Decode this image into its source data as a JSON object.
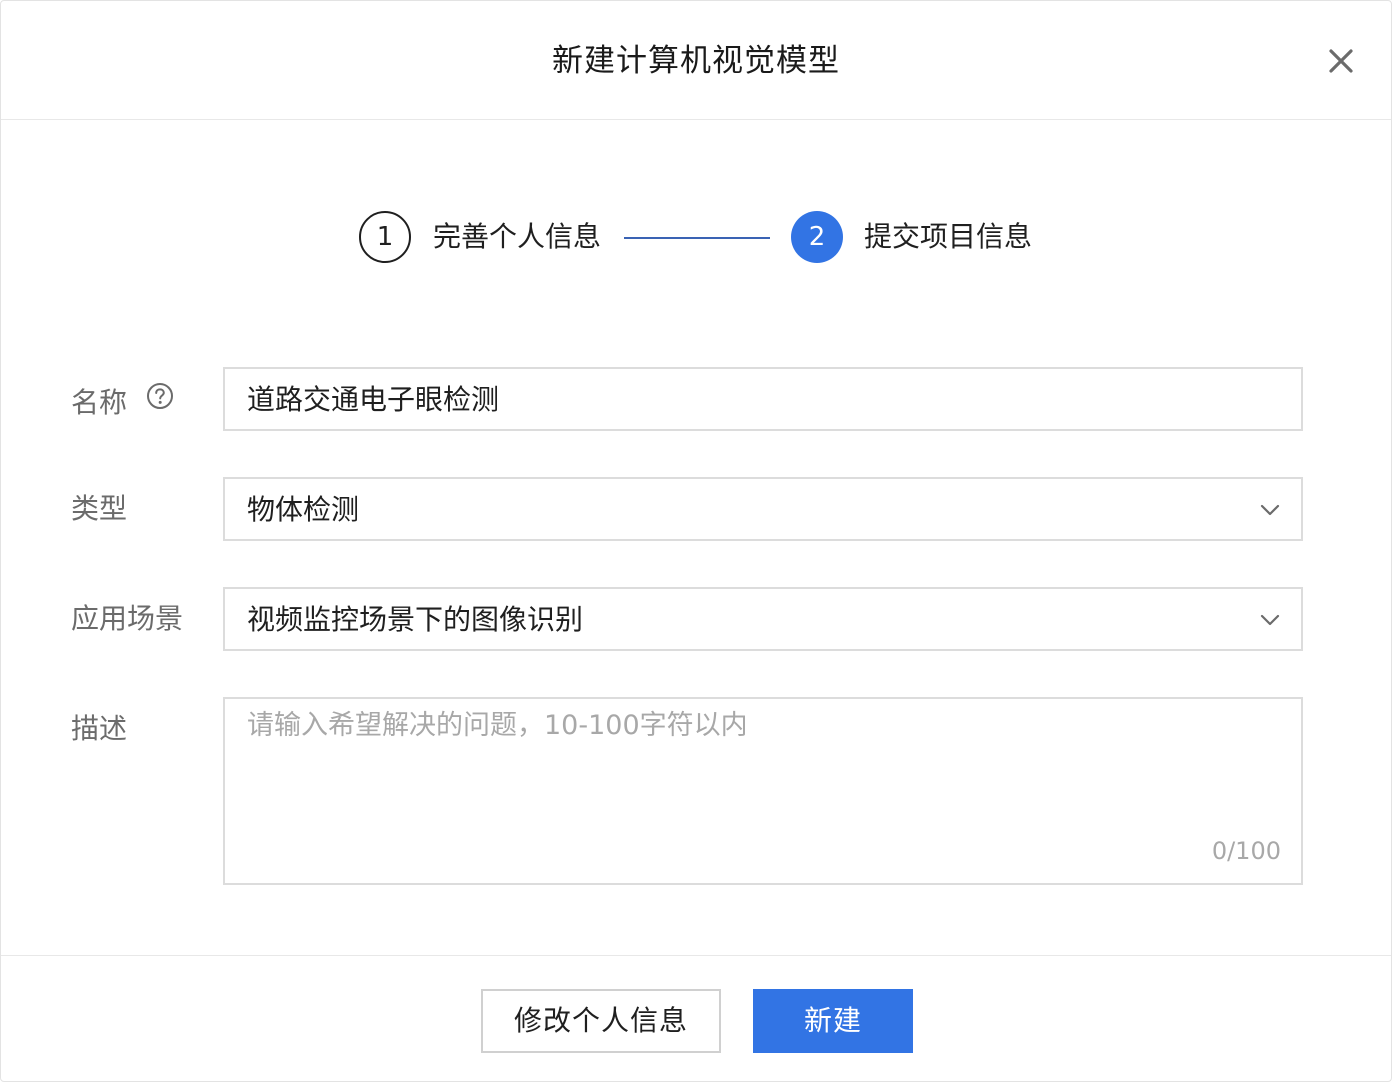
{
  "dialog": {
    "title": "新建计算机视觉模型",
    "close_icon": "close-icon"
  },
  "steps": [
    {
      "number": "1",
      "label": "完善个人信息",
      "state": "done"
    },
    {
      "number": "2",
      "label": "提交项目信息",
      "state": "active"
    }
  ],
  "form": {
    "name": {
      "label": "名称",
      "help_icon": "question-circle-icon",
      "value": "道路交通电子眼检测"
    },
    "type": {
      "label": "类型",
      "value": "物体检测",
      "icon": "chevron-down-icon"
    },
    "scenario": {
      "label": "应用场景",
      "value": "视频监控场景下的图像识别",
      "icon": "chevron-down-icon"
    },
    "description": {
      "label": "描述",
      "placeholder": "请输入希望解决的问题，10-100字符以内",
      "counter": "0/100"
    }
  },
  "footer": {
    "edit_label": "修改个人信息",
    "create_label": "新建"
  },
  "colors": {
    "primary": "#3274e4",
    "step_line": "#3a63b4",
    "border": "#dcdcdc",
    "label": "#6b6b6b",
    "placeholder": "#a8a8a8"
  }
}
